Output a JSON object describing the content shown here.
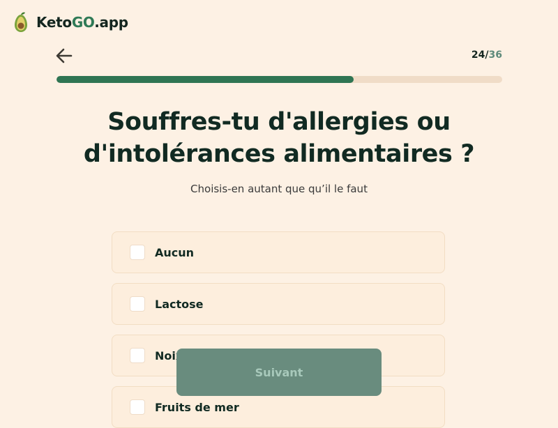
{
  "brand": {
    "name_prefix": "Keto",
    "name_go": "GO",
    "name_suffix": ".app",
    "accent": "#2f7a56"
  },
  "header": {
    "step_current": "24",
    "step_separator": "/",
    "step_total": "36"
  },
  "progress": {
    "fraction": 0.667
  },
  "question": {
    "title_line1": "Souffres-tu d'allergies ou",
    "title_line2": "d'intolérances alimentaires ?",
    "subtitle": "Choisis-en autant que qu’il le faut"
  },
  "options": [
    {
      "label": "Aucun",
      "checked": false
    },
    {
      "label": "Lactose",
      "checked": false
    },
    {
      "label": "Noix",
      "checked": false
    },
    {
      "label": "Fruits de mer",
      "checked": false
    }
  ],
  "footer": {
    "next_label": "Suivant"
  }
}
